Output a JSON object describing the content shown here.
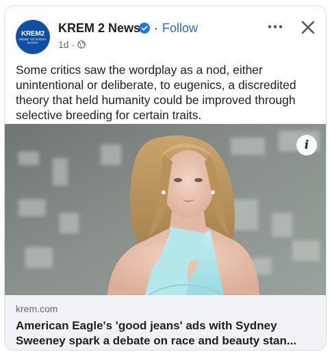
{
  "post": {
    "avatar": {
      "logo_main": "KREM2",
      "logo_sub": "MORE TO EVERY STORY",
      "brand_color": "#0f4fa8"
    },
    "page_name": "KREM 2 News",
    "separator": "·",
    "follow_label": "Follow",
    "time": "1d ·",
    "text": "Some critics saw the wordplay as a nod, either unintentional or deliberate, to eugenics, a discredited theory that held humanity could be improved through selective breeding for certain traits.",
    "info_label": "i"
  },
  "link_preview": {
    "domain": "krem.com",
    "headline": "American Eagle's 'good jeans' ads with Sydney Sweeney spark a debate on race and beauty stan..."
  },
  "colors": {
    "accent": "#1f6fd6",
    "text": "#1c1e21",
    "muted": "#65676b",
    "dress": "#a9e3e6"
  },
  "icons": [
    "verified-badge-icon",
    "globe-icon",
    "more-options-icon",
    "close-icon",
    "info-icon"
  ]
}
